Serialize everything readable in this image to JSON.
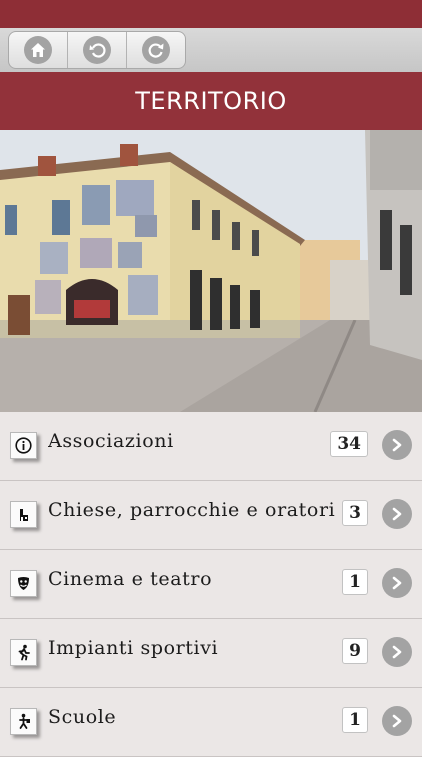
{
  "header": {
    "title": "TERRITORIO"
  },
  "toolbar": {
    "buttons": [
      {
        "icon": "home-icon"
      },
      {
        "icon": "back-icon"
      },
      {
        "icon": "refresh-icon"
      }
    ]
  },
  "photo": {
    "description_icon": "street-photo"
  },
  "list": [
    {
      "icon": "info-icon",
      "label": "Associazioni",
      "count": "34"
    },
    {
      "icon": "church-icon",
      "label": "Chiese, parrocchie e oratori",
      "count": "3"
    },
    {
      "icon": "theatre-mask-icon",
      "label": "Cinema e teatro",
      "count": "1"
    },
    {
      "icon": "runner-icon",
      "label": "Impianti sportivi",
      "count": "9"
    },
    {
      "icon": "student-icon",
      "label": "Scuole",
      "count": "1"
    }
  ],
  "colors": {
    "brand": "#92323a",
    "statusbar": "#8e2e36",
    "arrow": "#a3a3a3"
  }
}
